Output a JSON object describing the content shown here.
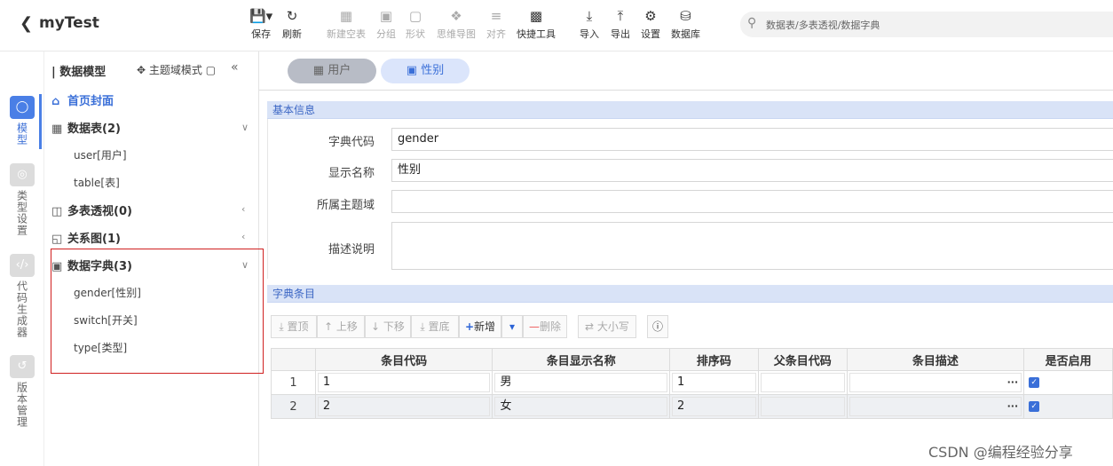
{
  "app": {
    "back_icon": "chevron-left-icon",
    "title": "myTest"
  },
  "toolbar": [
    {
      "label": "保存",
      "icon": "save-icon"
    },
    {
      "label": "刷新",
      "icon": "refresh-icon"
    },
    {
      "label": "新建空表",
      "icon": "new-table-icon"
    },
    {
      "label": "分组",
      "icon": "group-icon"
    },
    {
      "label": "形状",
      "icon": "shape-icon"
    },
    {
      "label": "思维导图",
      "icon": "mindmap-icon"
    },
    {
      "label": "对齐",
      "icon": "align-icon"
    },
    {
      "label": "快捷工具",
      "icon": "toolbox-icon"
    },
    {
      "label": "导入",
      "icon": "import-icon"
    },
    {
      "label": "导出",
      "icon": "export-icon"
    },
    {
      "label": "设置",
      "icon": "gear-icon"
    },
    {
      "label": "数据库",
      "icon": "database-icon"
    }
  ],
  "search": {
    "placeholder": "数据表/多表透视/数据字典"
  },
  "rail": [
    {
      "label": "模型",
      "icon": "cube-icon",
      "active": true
    },
    {
      "label": "类型设置",
      "icon": "globe-icon",
      "active": false
    },
    {
      "label": "代码生成器",
      "icon": "code-icon",
      "active": false
    },
    {
      "label": "版本管理",
      "icon": "history-icon",
      "active": false
    }
  ],
  "tree": {
    "title": "数据模型",
    "mode_label": "主题域模式",
    "home": "首页封面",
    "nodes": {
      "tables": {
        "label": "数据表(2)",
        "children": [
          "user[用户]",
          "table[表]"
        ]
      },
      "pivot": {
        "label": "多表透视(0)"
      },
      "relation": {
        "label": "关系图(1)"
      },
      "dict": {
        "label": "数据字典(3)",
        "children": [
          "gender[性别]",
          "switch[开关]",
          "type[类型]"
        ]
      }
    }
  },
  "tabs": [
    {
      "label": "用户",
      "icon": "table-icon"
    },
    {
      "label": "性别",
      "icon": "book-icon"
    }
  ],
  "basic": {
    "section": "基本信息",
    "code_label": "字典代码",
    "code_value": "gender",
    "name_label": "显示名称",
    "name_value": "性别",
    "domain_label": "所属主题域",
    "domain_value": "",
    "desc_label": "描述说明",
    "desc_value": ""
  },
  "items": {
    "section": "字典条目",
    "buttons": {
      "top": "置顶",
      "up": "上移",
      "down": "下移",
      "bottom": "置底",
      "add": "新增",
      "delete": "删除",
      "case": "大小写"
    },
    "columns": [
      "条目代码",
      "条目显示名称",
      "排序码",
      "父条目代码",
      "条目描述",
      "是否启用"
    ],
    "rows": [
      {
        "idx": "1",
        "code": "1",
        "name": "男",
        "sort": "1",
        "parent": "",
        "desc": "",
        "enabled": true
      },
      {
        "idx": "2",
        "code": "2",
        "name": "女",
        "sort": "2",
        "parent": "",
        "desc": "",
        "enabled": true
      }
    ]
  },
  "watermark": "CSDN @编程经验分享"
}
